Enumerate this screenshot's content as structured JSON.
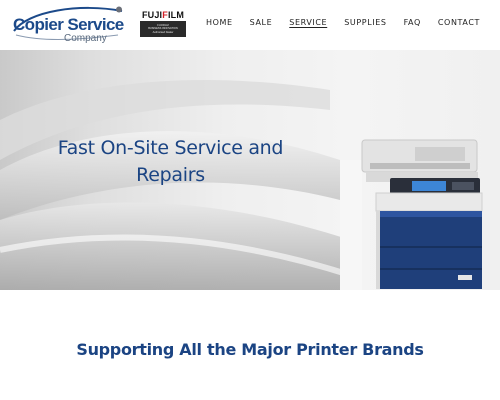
{
  "header": {
    "logo": {
      "main": "Copier Service",
      "sub": "Company"
    },
    "partner": {
      "brand_prefix": "FUJI",
      "brand_accent": "F",
      "brand_suffix": "ILM",
      "badge_lines": [
        "FUJIFILM",
        "BUSINESS INNOVATION",
        "Authorised Dealer"
      ]
    },
    "nav": [
      {
        "label": "HOME"
      },
      {
        "label": "SALE"
      },
      {
        "label": "SERVICE"
      },
      {
        "label": "SUPPLIES"
      },
      {
        "label": "FAQ"
      },
      {
        "label": "CONTACT"
      }
    ],
    "active_nav": "SERVICE"
  },
  "hero": {
    "title": "Fast On-Site Service and Repairs"
  },
  "section": {
    "title": "Supporting All the Major Printer Brands"
  },
  "colors": {
    "brand_blue": "#1b4483",
    "fuji_red": "#d21f26"
  }
}
